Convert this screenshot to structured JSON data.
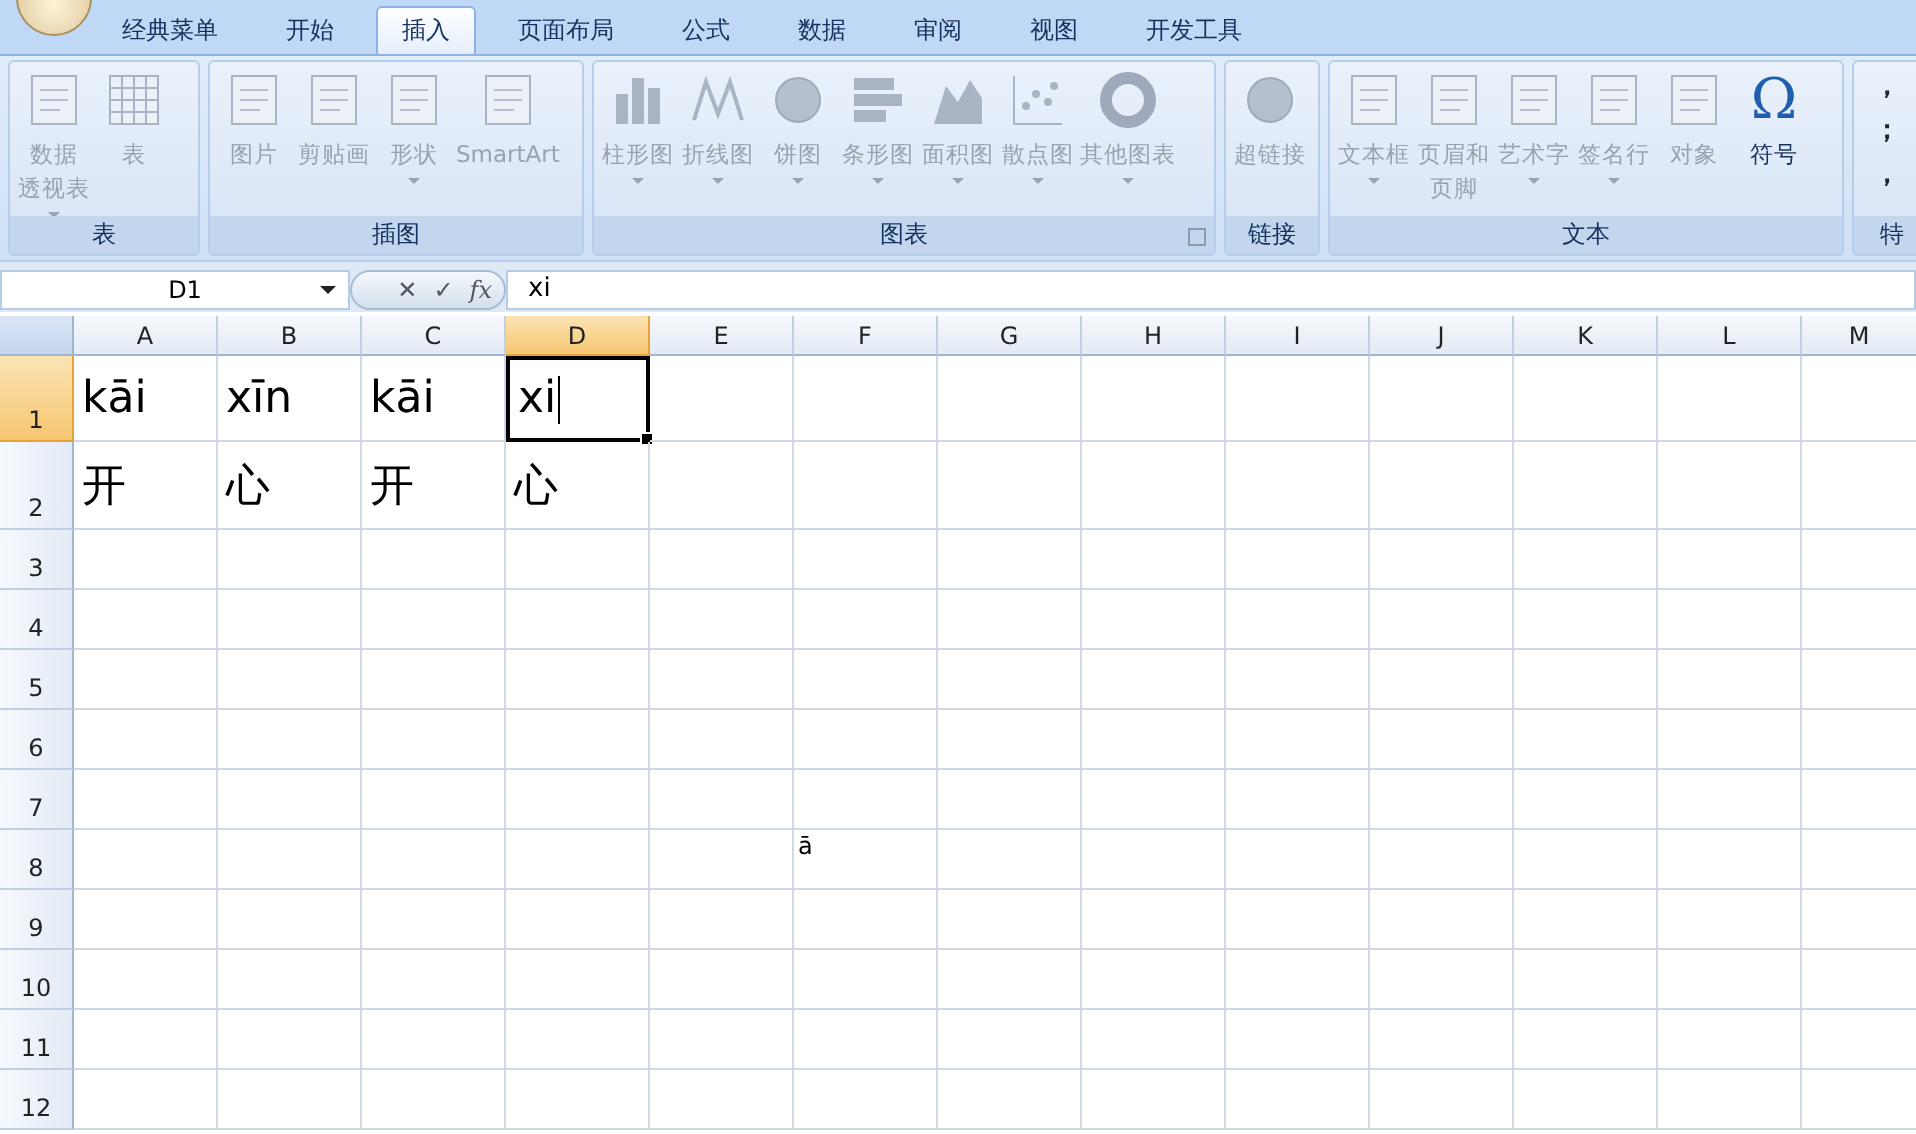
{
  "tabs": [
    {
      "label": "经典菜单",
      "selected": false
    },
    {
      "label": "开始",
      "selected": false
    },
    {
      "label": "插入",
      "selected": true
    },
    {
      "label": "页面布局",
      "selected": false
    },
    {
      "label": "公式",
      "selected": false
    },
    {
      "label": "数据",
      "selected": false
    },
    {
      "label": "审阅",
      "selected": false
    },
    {
      "label": "视图",
      "selected": false
    },
    {
      "label": "开发工具",
      "selected": false
    }
  ],
  "ribbon_groups": [
    {
      "label": "表",
      "items": [
        {
          "label": [
            "数据",
            "透视表"
          ],
          "disabled": true,
          "dropdown": true
        },
        {
          "label": [
            "表"
          ],
          "disabled": true,
          "dropdown": false
        }
      ]
    },
    {
      "label": "插图",
      "items": [
        {
          "label": [
            "图片"
          ],
          "disabled": true,
          "dropdown": false
        },
        {
          "label": [
            "剪贴画"
          ],
          "disabled": true,
          "dropdown": false
        },
        {
          "label": [
            "形状"
          ],
          "disabled": true,
          "dropdown": true
        },
        {
          "label": [
            "SmartArt"
          ],
          "disabled": true,
          "dropdown": false
        }
      ]
    },
    {
      "label": "图表",
      "launcher": true,
      "items": [
        {
          "label": [
            "柱形图"
          ],
          "disabled": true,
          "dropdown": true
        },
        {
          "label": [
            "折线图"
          ],
          "disabled": true,
          "dropdown": true
        },
        {
          "label": [
            "饼图"
          ],
          "disabled": true,
          "dropdown": true
        },
        {
          "label": [
            "条形图"
          ],
          "disabled": true,
          "dropdown": true
        },
        {
          "label": [
            "面积图"
          ],
          "disabled": true,
          "dropdown": true
        },
        {
          "label": [
            "散点图"
          ],
          "disabled": true,
          "dropdown": true
        },
        {
          "label": [
            "其他图表"
          ],
          "disabled": true,
          "dropdown": true
        }
      ]
    },
    {
      "label": "链接",
      "items": [
        {
          "label": [
            "超链接"
          ],
          "disabled": true,
          "dropdown": false
        }
      ]
    },
    {
      "label": "文本",
      "items": [
        {
          "label": [
            "文本框"
          ],
          "disabled": true,
          "dropdown": true
        },
        {
          "label": [
            "页眉和",
            "页脚"
          ],
          "disabled": true,
          "dropdown": false
        },
        {
          "label": [
            "艺术字"
          ],
          "disabled": true,
          "dropdown": true
        },
        {
          "label": [
            "签名行"
          ],
          "disabled": true,
          "dropdown": true
        },
        {
          "label": [
            "对象"
          ],
          "disabled": true,
          "dropdown": false
        },
        {
          "label": [
            "符号"
          ],
          "disabled": false,
          "dropdown": false,
          "glyph": "Ω"
        }
      ]
    },
    {
      "label": "特",
      "symbols": [
        "，",
        "；",
        "，"
      ]
    }
  ],
  "formula_bar": {
    "name_box": "D1",
    "buttons": [
      "✕",
      "✓",
      "fx"
    ],
    "value": "xi"
  },
  "columns": [
    {
      "label": "A",
      "selected": false
    },
    {
      "label": "B",
      "selected": false
    },
    {
      "label": "C",
      "selected": false
    },
    {
      "label": "D",
      "selected": true
    },
    {
      "label": "E",
      "selected": false
    },
    {
      "label": "F",
      "selected": false
    },
    {
      "label": "G",
      "selected": false
    },
    {
      "label": "H",
      "selected": false
    },
    {
      "label": "I",
      "selected": false
    },
    {
      "label": "J",
      "selected": false
    },
    {
      "label": "K",
      "selected": false
    },
    {
      "label": "L",
      "selected": false
    },
    {
      "label": "M",
      "selected": false
    }
  ],
  "rows": [
    {
      "header": "1",
      "selected": true,
      "cells": [
        {
          "text": "kāi",
          "selected": false
        },
        {
          "text": "xīn",
          "selected": false
        },
        {
          "text": "kāi",
          "selected": false
        },
        {
          "text": "xi",
          "selected": true
        }
      ]
    },
    {
      "header": "2",
      "selected": false,
      "cells": [
        {
          "text": "开",
          "selected": false
        },
        {
          "text": "心",
          "selected": false
        },
        {
          "text": "开",
          "selected": false
        },
        {
          "text": "心",
          "selected": false
        }
      ]
    },
    {
      "header": "3",
      "selected": false
    },
    {
      "header": "4",
      "selected": false
    },
    {
      "header": "5",
      "selected": false
    },
    {
      "header": "6",
      "selected": false
    },
    {
      "header": "7",
      "selected": false
    },
    {
      "header": "8",
      "selected": false
    },
    {
      "header": "9",
      "selected": false
    },
    {
      "header": "10",
      "selected": false
    },
    {
      "header": "11",
      "selected": false
    },
    {
      "header": "12",
      "selected": false
    }
  ],
  "ime_popup": {
    "text": "ā"
  }
}
